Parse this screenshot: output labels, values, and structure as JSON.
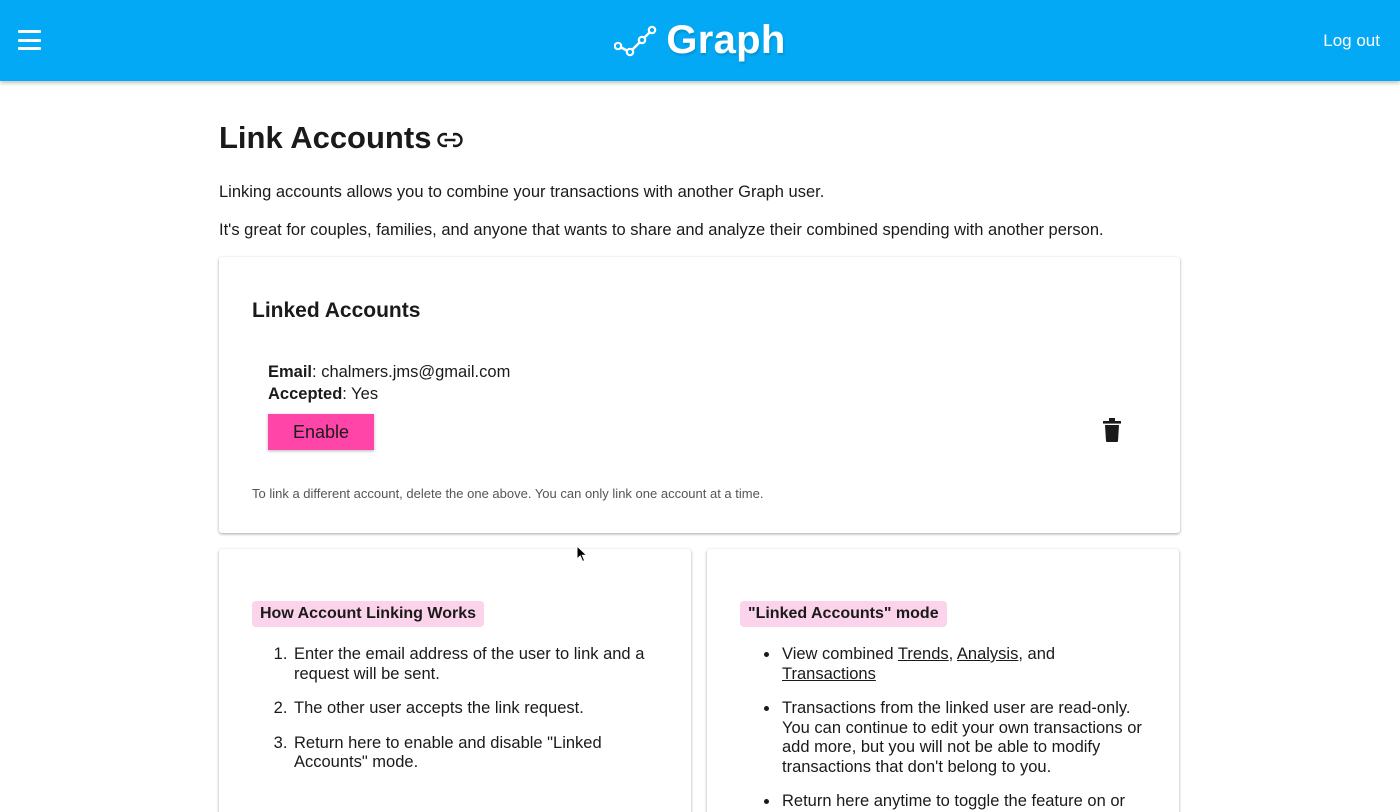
{
  "header": {
    "brand_name": "Graph",
    "logout_label": "Log out"
  },
  "page": {
    "title": "Link Accounts",
    "intro_1": "Linking accounts allows you to combine your transactions with another Graph user.",
    "intro_2": "It's great for couples, families, and anyone that wants to share and analyze their combined spending with another person."
  },
  "linked_accounts": {
    "heading": "Linked Accounts",
    "email_label": "Email",
    "email_value": "chalmers.jms@gmail.com",
    "accepted_label": "Accepted",
    "accepted_value": "Yes",
    "enable_label": "Enable",
    "note": "To link a different account, delete the one above. You can only link one account at a time."
  },
  "how_it_works": {
    "tag": "How Account Linking Works",
    "steps": [
      "Enter the email address of the user to link and a request will be sent.",
      "The other user accepts the link request.",
      "Return here to enable and disable \"Linked Accounts\" mode."
    ]
  },
  "mode": {
    "tag": "\"Linked Accounts\" mode",
    "item1_prefix": "View combined ",
    "link_trends": "Trends",
    "sep1": ", ",
    "link_analysis": "Analysis",
    "sep2": ", and ",
    "link_transactions": "Transactions",
    "item2": "Transactions from the linked user are read-only. You can continue to edit your own transactions or add more, but you will not be able to modify transactions that don't belong to you.",
    "item3": "Return here anytime to toggle the feature on or off."
  },
  "colors": {
    "header_bg": "#03a9f4",
    "accent_pink": "#ff45a8",
    "tag_bg": "#fbd3ea"
  },
  "icons": {
    "menu": "hamburger-menu-icon",
    "brand": "graph-line-icon",
    "title": "link-icon",
    "delete": "trash-icon"
  }
}
